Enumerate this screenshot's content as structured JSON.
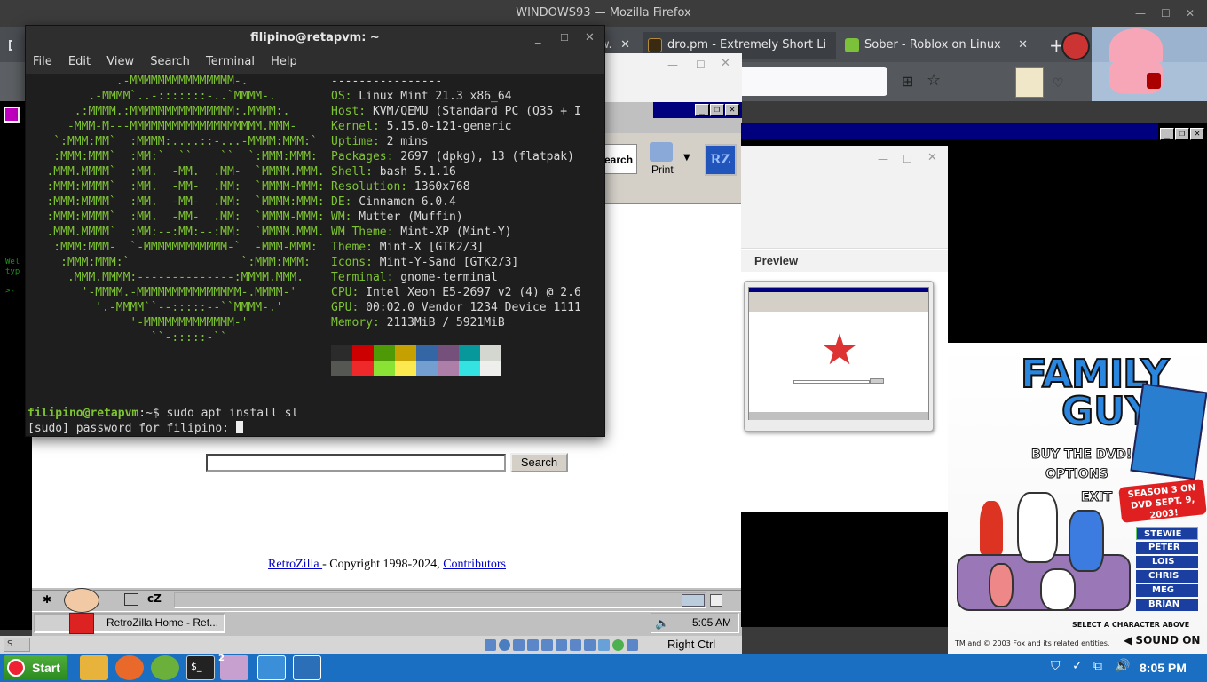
{
  "firefox": {
    "window_title": "WINDOWS93 — Mozilla Firefox",
    "tabs": [
      {
        "label": "dro.pm - Extremely Short Li"
      },
      {
        "label": "Sober - Roblox on Linux"
      }
    ],
    "partial_tab_label": "w."
  },
  "terminal": {
    "title": "filipino@retapvm: ~",
    "menu": [
      "File",
      "Edit",
      "View",
      "Search",
      "Terminal",
      "Help"
    ],
    "ascii_art": [
      "             .-MMMMMMMMMMMMMMM-.",
      "         .-MMMM`..-:::::::-..`MMMM-.",
      "       .:MMMM.:MMMMMMMMMMMMMMM:.MMMM:.",
      "      -MMM-M---MMMMMMMMMMMMMMMMMMM.MMM-",
      "    `:MMM:MM`  :MMMM:....::-...-MMMM:MMM:`",
      "    :MMM:MMM`  :MM:`  ``    ``  `:MMM:MMM:",
      "   .MMM.MMMM`  :MM.  -MM.  .MM-  `MMMM.MMM.",
      "   :MMM:MMMM`  :MM.  -MM-  .MM:  `MMMM-MMM:",
      "   :MMM:MMMM`  :MM.  -MM-  .MM:  `MMMM:MMM:",
      "   :MMM:MMMM`  :MM.  -MM-  .MM:  `MMMM-MMM:",
      "   .MMM.MMMM`  :MM:--:MM:--:MM:  `MMMM.MMM.",
      "    :MMM:MMM-  `-MMMMMMMMMMMM-`  -MMM-MMM:",
      "     :MMM:MMM:`                `:MMM:MMM:",
      "      .MMM.MMMM:--------------:MMMM.MMM.",
      "        '-MMMM.-MMMMMMMMMMMMMMM-.MMMM-'",
      "          '.-MMMM``--:::::--``MMMM-.'",
      "               '-MMMMMMMMMMMMM-'",
      "                  ``-:::::-``"
    ],
    "separator": "----------------",
    "info": [
      {
        "key": "OS",
        "value": "Linux Mint 21.3 x86_64"
      },
      {
        "key": "Host",
        "value": "KVM/QEMU (Standard PC (Q35 + I"
      },
      {
        "key": "Kernel",
        "value": "5.15.0-121-generic"
      },
      {
        "key": "Uptime",
        "value": "2 mins"
      },
      {
        "key": "Packages",
        "value": "2697 (dpkg), 13 (flatpak)"
      },
      {
        "key": "Shell",
        "value": "bash 5.1.16"
      },
      {
        "key": "Resolution",
        "value": "1360x768"
      },
      {
        "key": "DE",
        "value": "Cinnamon 6.0.4"
      },
      {
        "key": "WM",
        "value": "Mutter (Muffin)"
      },
      {
        "key": "WM Theme",
        "value": "Mint-XP (Mint-Y)"
      },
      {
        "key": "Theme",
        "value": "Mint-X [GTK2/3]"
      },
      {
        "key": "Icons",
        "value": "Mint-Y-Sand [GTK2/3]"
      },
      {
        "key": "Terminal",
        "value": "gnome-terminal"
      },
      {
        "key": "CPU",
        "value": "Intel Xeon E5-2697 v2 (4) @ 2.6"
      },
      {
        "key": "GPU",
        "value": "00:02.0 Vendor 1234 Device 1111"
      },
      {
        "key": "Memory",
        "value": "2113MiB / 5921MiB"
      }
    ],
    "palette_top": [
      "#2b2b2b",
      "#cc0000",
      "#4e9a06",
      "#c4a000",
      "#3465a4",
      "#75507b",
      "#06989a",
      "#d3d7cf"
    ],
    "palette_bottom": [
      "#555753",
      "#ef2929",
      "#8ae234",
      "#fce94f",
      "#729fcf",
      "#ad7fa8",
      "#34e2e2",
      "#eeeeec"
    ],
    "prompt_user": "filipino@retapvm",
    "prompt_path": ":~$ ",
    "command": "sudo apt install sl",
    "sudo_prompt": "[sudo] password for filipino: "
  },
  "retrozilla": {
    "print_label": "Print",
    "search_partial": "earch",
    "search_button": "Search",
    "copyright_link": "RetroZilla ",
    "copyright_text": "- Copyright 1998-2024, ",
    "contributors_link": "Contributors",
    "taskbar_item": "RetroZilla Home - Ret...",
    "tray_time": "5:05 AM"
  },
  "preview": {
    "label": "Preview"
  },
  "vbox": {
    "host_key": "Right Ctrl"
  },
  "ad": {
    "title_line1": "FAMILY",
    "title_line2": "GUY",
    "buy": "BUY THE DVD!",
    "options": "OPTIONS",
    "exit": "EXIT",
    "season": "SEASON 3 ON DVD SEPT. 9, 2003!",
    "characters": [
      "STEWIE",
      "PETER",
      "LOIS",
      "CHRIS",
      "MEG",
      "BRIAN"
    ],
    "select": "SELECT A CHARACTER ABOVE",
    "sound": "SOUND ON",
    "legal": "TM and © 2003 Fox and its related entities."
  },
  "mint": {
    "start": "Start",
    "clock": "8:05 PM",
    "badge": "2"
  },
  "colors": {
    "mint_green": "#7ec432",
    "w95_blue": "#00007f",
    "mint_panel": "#1a6fc2"
  }
}
